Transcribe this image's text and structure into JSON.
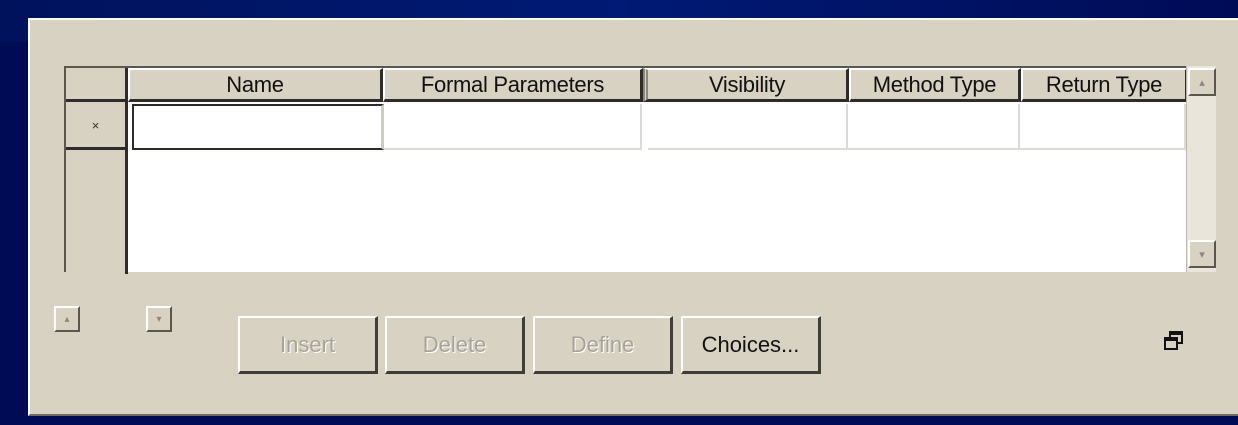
{
  "grid": {
    "columns": [
      "Name",
      "Formal Parameters",
      "Visibility",
      "Method Type",
      "Return Type"
    ],
    "new_row_marker": "×"
  },
  "scrollbar": {
    "up_glyph": "▴",
    "down_glyph": "▾"
  },
  "row_nav": {
    "up_glyph": "▴",
    "down_glyph": "▾"
  },
  "buttons": {
    "insert": "Insert",
    "delete": "Delete",
    "define": "Define",
    "choices": "Choices..."
  },
  "icons": {
    "restore": "restore-window-icon"
  }
}
